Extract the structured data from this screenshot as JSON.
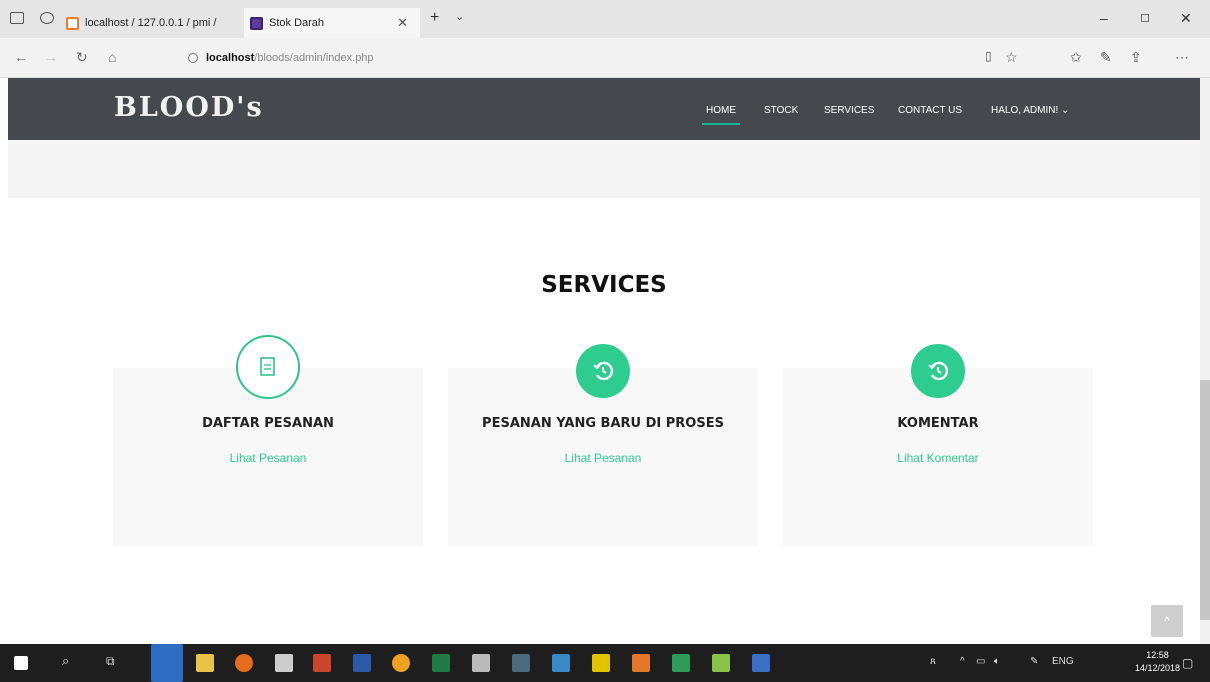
{
  "browser": {
    "tabs": [
      {
        "label": "localhost / 127.0.0.1 / pmi /",
        "active": false,
        "favicon": "orange-square"
      },
      {
        "label": "Stok Darah",
        "active": true,
        "favicon": "purple-square"
      }
    ],
    "address": {
      "host": "localhost",
      "path": "/bloods/admin/index.php"
    }
  },
  "site": {
    "logo": "BLOOD's",
    "nav": [
      {
        "label": "HOME",
        "active": true
      },
      {
        "label": "STOCK",
        "active": false
      },
      {
        "label": "SERVICES",
        "active": false
      },
      {
        "label": "CONTACT US",
        "active": false
      },
      {
        "label": "HALO, ADMIN! ⌄",
        "active": false
      }
    ],
    "accent": "#2ecc8f"
  },
  "services": {
    "title": "SERVICES",
    "cards": [
      {
        "title": "DAFTAR PESANAN",
        "link": "Lihat Pesanan",
        "icon": "document-icon"
      },
      {
        "title": "PESANAN YANG BARU DI PROSES",
        "link": "Lihat Pesanan",
        "icon": "history-icon"
      },
      {
        "title": "KOMENTAR",
        "link": "Lihat Komentar",
        "icon": "history-icon"
      }
    ]
  },
  "taskbar": {
    "lang": "ENG",
    "time": "12:58",
    "date": "14/12/2018"
  }
}
